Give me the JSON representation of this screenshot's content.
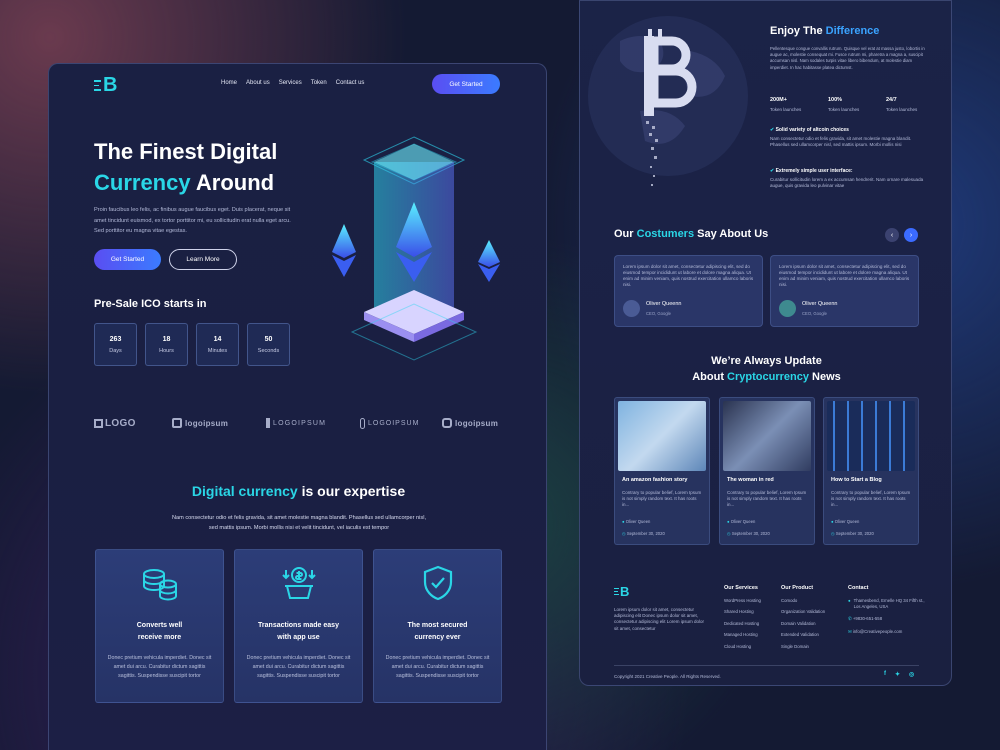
{
  "left": {
    "brand_letter": "B",
    "nav": [
      "Home",
      "About us",
      "Services",
      "Token",
      "Contact us"
    ],
    "nav_cta": "Get Started",
    "hero": {
      "line1": "The Finest Digital",
      "line2_accent": "Currency",
      "line2_rest": "Around",
      "desc": "Proin faucibus leo felis, ac finibus augue faucibus eget. Duis placerat, neque sit amet tincidunt euismod, ex tortor porttitor mi, eu sollicitudin erat nulla eget arcu. Sed porttitor eu magna vitae egestas.",
      "primary": "Get Started",
      "secondary": "Learn More"
    },
    "presale": {
      "title": "Pre-Sale ICO starts in",
      "counters": [
        {
          "value": "263",
          "label": "Days"
        },
        {
          "value": "18",
          "label": "Hours"
        },
        {
          "value": "14",
          "label": "Minutes"
        },
        {
          "value": "50",
          "label": "Seconds"
        }
      ]
    },
    "logos": [
      "LOGO",
      "logoipsum",
      "LOGOIPSUM",
      "LOGOIPSUM",
      "logoipsum"
    ],
    "expertise": {
      "title_accent": "Digital currency",
      "title_rest": "is our expertise",
      "desc": "Nam consectetur odio et felis gravida, sit amet molestie magna blandit. Phasellus sed ullamcorper nisl, sed mattis ipsum. Morbi mollis nisi et velit tincidunt, vel iaculis est tempor",
      "cards": [
        {
          "icon": "coins-stack-icon",
          "title1": "Converts well",
          "title2": "receive more",
          "desc": "Donec pretium vehicula imperdiet. Donec sit amet dui arcu. Curabitur dictum sagittis sagittis. Suspendisse suscipit tortor"
        },
        {
          "icon": "dollar-cart-icon",
          "title1": "Transactions made easy",
          "title2": "with app use",
          "desc": "Donec pretium vehicula imperdiet. Donec sit amet dui arcu. Curabitur dictum sagittis sagittis. Suspendisse suscipit tortor"
        },
        {
          "icon": "shield-check-icon",
          "title1": "The most secured",
          "title2": "currency ever",
          "desc": "Donec pretium vehicula imperdiet. Donec sit amet dui arcu. Curabitur dictum sagittis sagittis. Suspendisse suscipit tortor"
        }
      ]
    }
  },
  "right": {
    "enjoy": {
      "title_a": "Enjoy The",
      "title_accent": "Difference",
      "desc": "Pellentesque congue convallis rutrum. Quisque vel erat at massa justo, lobortis in augue ac, molestie consequat mi. Fusce rutrum mi, pharetra a magna a, suscipit accumsan nisl. Nam sodales turpis vitae libero bibendum, at molestie diam imperdiet. In hac habitasse platea dictumst.",
      "stats": [
        {
          "value": "200M+",
          "label": "Token launches"
        },
        {
          "value": "100%",
          "label": "Token launches"
        },
        {
          "value": "24/7",
          "label": "Token launches"
        }
      ],
      "features": [
        {
          "title": "Solid variety of altcoin choices",
          "desc": "Nam consectetur odio et felis gravida, sit amet molestie magna blandit. Phasellus sed ullamcorper nisl, sed mattis ipsum. Morbi mollis nisi"
        },
        {
          "title": "Extremely simple user interface:",
          "desc": "Curabitur sollicitudin lorem a ex accumsan hendrerit. Nam ornare malesuada augue, quis gravida leo pulvinar vitae"
        }
      ]
    },
    "testimonials": {
      "title_a": "Our",
      "title_accent": "Costumers",
      "title_b": "Say About Us",
      "items": [
        {
          "text": "Lorem ipsum dolor sit amet, consectetur adipiscing elit, sed do eiusmod tempor incididunt ut labore et dolore magna aliqua. Ut enim ad minim veniam, quis nostrud exercitation ullamco laboris nisi.",
          "name": "Oliver Queenn",
          "role": "CEO, Google"
        },
        {
          "text": "Lorem ipsum dolor sit amet, consectetur adipiscing elit, sed do eiusmod tempor incididunt ut labore et dolore magna aliqua. Ut enim ad minim veniam, quis nostrud exercitation ullamco laboris nisi.",
          "name": "Oliver Queenn",
          "role": "CEO, Google"
        }
      ]
    },
    "news": {
      "title_line1": "We’re Always Update",
      "title_a": "About",
      "title_accent": "Cryptocurrency",
      "title_b": "News",
      "items": [
        {
          "title": "An amazon fashion story",
          "desc": "Contrary to popular belief, Lorem Ipsum is not simply random text. It has roots in...",
          "author": "Oliver Queen",
          "date": "September 30, 2020"
        },
        {
          "title": "The woman in red",
          "desc": "Contrary to popular belief, Lorem Ipsum is not simply random text. It has roots in...",
          "author": "Oliver Queen",
          "date": "September 30, 2020"
        },
        {
          "title": "How to Start a Blog",
          "desc": "Contrary to popular belief, Lorem Ipsum is not simply random text. It has roots in...",
          "author": "Oliver Queen",
          "date": "September 30, 2020"
        }
      ]
    },
    "footer": {
      "about": "Lorem ipsum dolor sit amet, consectetur adipiscing elit Donec ipsum dolor sit amet, consectetur adipiscing elit Lorem ipsum dolor sit amet, consectetur",
      "services_title": "Our Services",
      "services": [
        "WordPress Hosting",
        "Shared Hosting",
        "Dedicated Hosting",
        "Managed Hosting",
        "Cloud Hosting"
      ],
      "product_title": "Our Product",
      "products": [
        "Comodo",
        "Organization Validation",
        "Domain Validation",
        "Extended Validation",
        "Single Domain"
      ],
      "contact_title": "Contact",
      "address": "Thamesbend, Ernelle HQ 34 Fifth st., Los Angeles, USA",
      "phone": "+9830-651-558",
      "email": "info@Creativepeople.com",
      "copyright": "Copyright 2021 Creative People. All Rights Reserved."
    }
  },
  "colors": {
    "accent_cyan": "#2ad6e6",
    "accent_blue": "#3b7bff",
    "panel": "#1b2246"
  }
}
